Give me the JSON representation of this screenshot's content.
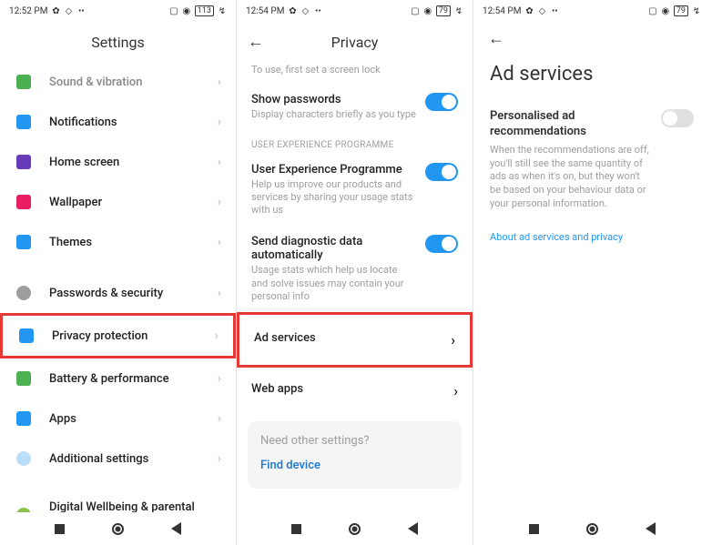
{
  "screen1": {
    "time": "12:52 PM",
    "battery": "113",
    "title": "Settings",
    "items": [
      {
        "label": "Sound & vibration",
        "color": "#4caf50"
      },
      {
        "label": "Notifications",
        "color": "#2196f3"
      },
      {
        "label": "Home screen",
        "color": "#673ab7"
      },
      {
        "label": "Wallpaper",
        "color": "#e91e63"
      },
      {
        "label": "Themes",
        "color": "#2196f3"
      }
    ],
    "items2": [
      {
        "label": "Passwords & security",
        "color": "#9e9e9e"
      },
      {
        "label": "Privacy protection",
        "color": "#2196f3",
        "hl": true
      },
      {
        "label": "Battery & performance",
        "color": "#4caf50"
      },
      {
        "label": "Apps",
        "color": "#2196f3"
      },
      {
        "label": "Additional settings",
        "color": "#bbdefb"
      }
    ],
    "items3": [
      {
        "label": "Digital Wellbeing & parental controls",
        "color": "#8bc34a"
      }
    ]
  },
  "screen2": {
    "time": "12:54 PM",
    "battery": "79",
    "title": "Privacy",
    "hint": "To use, first set a screen lock",
    "show_passwords": "Show passwords",
    "show_passwords_sub": "Display characters briefly as you type",
    "section": "USER EXPERIENCE PROGRAMME",
    "uep": "User Experience Programme",
    "uep_sub": "Help us improve our products and services by sharing your usage stats with us",
    "diag": "Send diagnostic data automatically",
    "diag_sub": "Usage stats which help us locate and solve issues may contain your personal info",
    "ad": "Ad services",
    "web": "Web apps",
    "card_q": "Need other settings?",
    "card_link": "Find device"
  },
  "screen3": {
    "time": "12:54 PM",
    "battery": "79",
    "title": "Ad services",
    "row_title": "Personalised ad recommendations",
    "row_desc": "When the recommendations are off, you'll still see the same quantity of ads as when it's on, but they won't be based on your behaviour data or your personal information.",
    "link": "About ad services and privacy"
  }
}
